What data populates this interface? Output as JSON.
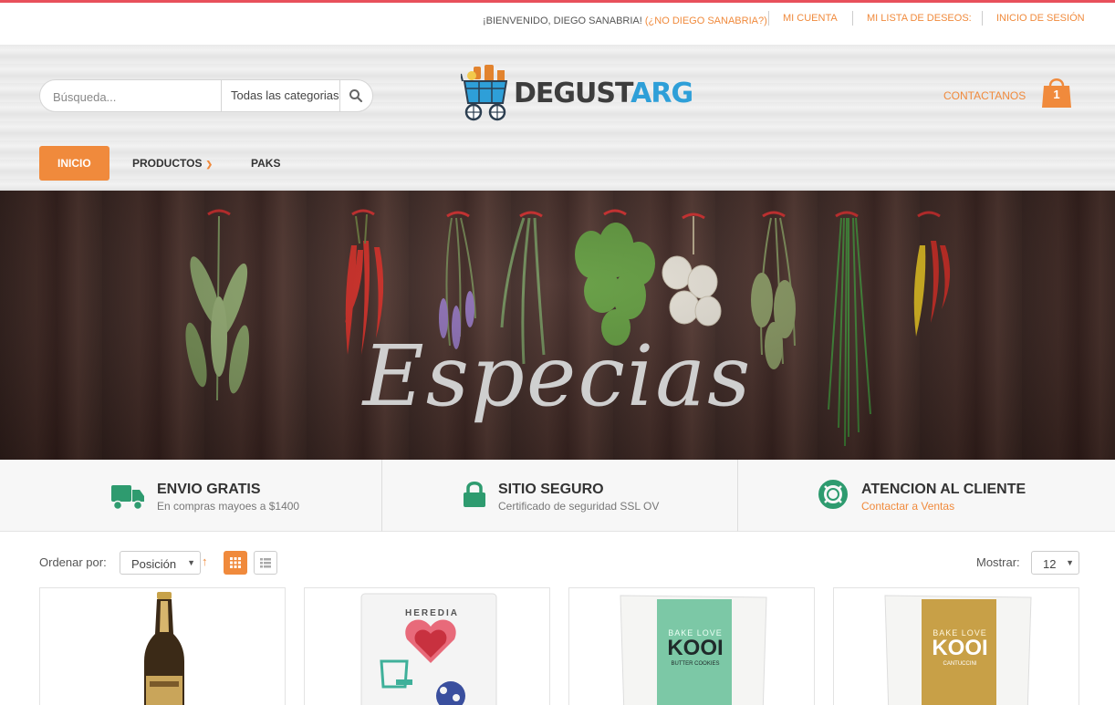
{
  "topbar": {
    "welcome": "¡BIENVENIDO, DIEGO SANABRIA!",
    "not_user": "(¿NO DIEGO SANABRIA?)",
    "links": [
      "MI CUENTA",
      "MI LISTA DE DESEOS:",
      "INICIO DE SESIÓN"
    ]
  },
  "search": {
    "placeholder": "Búsqueda...",
    "category": "Todas las categorias",
    "icon": "search-icon"
  },
  "logo": {
    "part1": "DEGUST",
    "part2": "ARG"
  },
  "header": {
    "contact": "CONTACTANOS",
    "cart_count": "1",
    "cart_icon": "shopping-bag-icon"
  },
  "nav": {
    "items": [
      {
        "label": "INICIO",
        "active": true
      },
      {
        "label": "PRODUCTOS",
        "has_dropdown": true
      },
      {
        "label": "PAKS"
      }
    ]
  },
  "banner": {
    "title": "Especias"
  },
  "features": [
    {
      "title": "ENVIO GRATIS",
      "subtitle": "En compras mayoes a $1400",
      "icon": "truck-icon"
    },
    {
      "title": "SITIO SEGURO",
      "subtitle": "Certificado de seguridad SSL OV",
      "icon": "lock-icon"
    },
    {
      "title": "ATENCION AL CLIENTE",
      "subtitle": "Contactar a Ventas",
      "icon": "lifebuoy-icon"
    }
  ],
  "toolbar": {
    "sort_label": "Ordenar por:",
    "sort_value": "Posición",
    "show_label": "Mostrar:",
    "show_value": "12",
    "view_modes": [
      "grid-view-icon",
      "list-view-icon"
    ]
  },
  "products": [
    {
      "image": "beer-bottle"
    },
    {
      "image": "heredia-package",
      "label": "HEREDIA"
    },
    {
      "image": "kooi-butter-cookies",
      "brand": "KOOI",
      "line1": "BAKE LOVE",
      "line2": "BUTTER COOKIES"
    },
    {
      "image": "kooi-cantuccini",
      "brand": "KOOI",
      "line1": "BAKE LOVE",
      "line2": "CANTUCCINI"
    }
  ],
  "colors": {
    "accent": "#f08a3c",
    "feature_green": "#2e9b6f",
    "topline": "#e8505b"
  }
}
